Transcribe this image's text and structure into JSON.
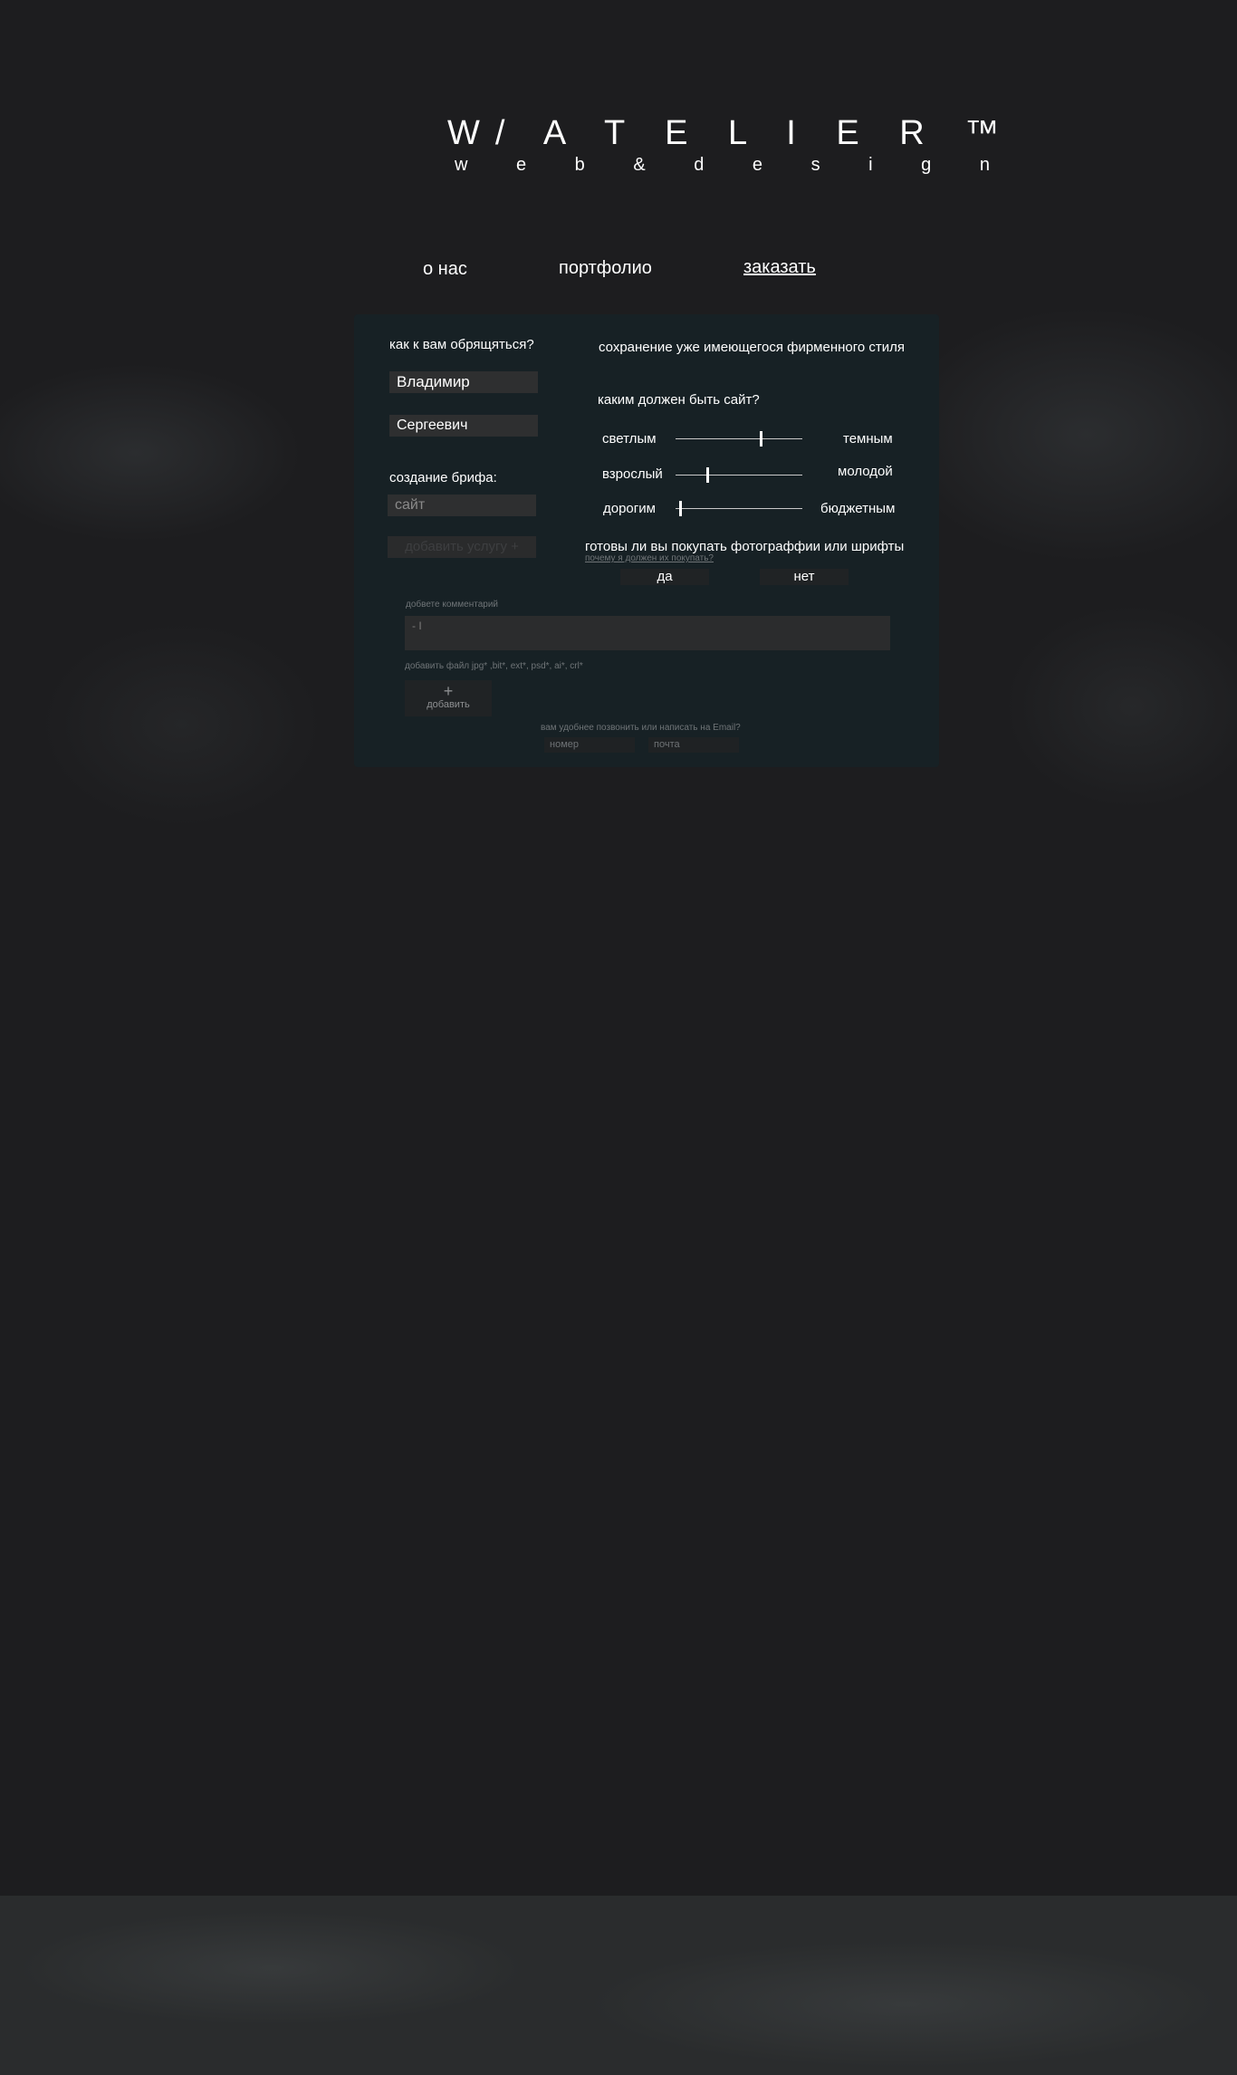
{
  "brand": {
    "title": "W/ A T E L I E R ™",
    "subtitle": "w e b & d e s i g n"
  },
  "nav": [
    {
      "label": "о нас"
    },
    {
      "label": "портфолио"
    },
    {
      "label": "заказать",
      "active": true
    }
  ],
  "form": {
    "name_question": "как к вам обрящяться?",
    "first_name": "Владимир",
    "patronymic": "Сергеевич",
    "brief_label": "создание брифа:",
    "service_placeholder": "сайт",
    "add_service_button": "добавить услугу +",
    "brand_style": "сохранение уже имеющегося фирменного стиля",
    "site_question": "каким должен быть сайт?",
    "sliders": [
      {
        "left": "светлым",
        "right": "темным",
        "value": 0.68
      },
      {
        "left": "взрослый",
        "right": "молодой",
        "value": 0.25
      },
      {
        "left": "дорогим",
        "right": "бюджетным",
        "value": 0.03
      }
    ],
    "photos_question": "готовы ли вы покупать фотограффии или шрифты",
    "photos_why_link": "почему я должен их покупать?",
    "yes": "да",
    "no": "нет",
    "comment_label": "добвете комментарий",
    "comment_value": "- I",
    "file_label": "добавить файл jpg* ,bit*, ext*, psd*, ai*, crl*",
    "add_file_plus": "+",
    "add_file_button": "добавить",
    "contact_question": "вам удобнее позвонить или написать на Email?",
    "phone_placeholder": "номер",
    "email_placeholder": "почта"
  },
  "colors": {
    "background": "#1d1d1f",
    "panel": "#172125",
    "field": "#2e2f30",
    "footer": "#2a2c2d"
  }
}
